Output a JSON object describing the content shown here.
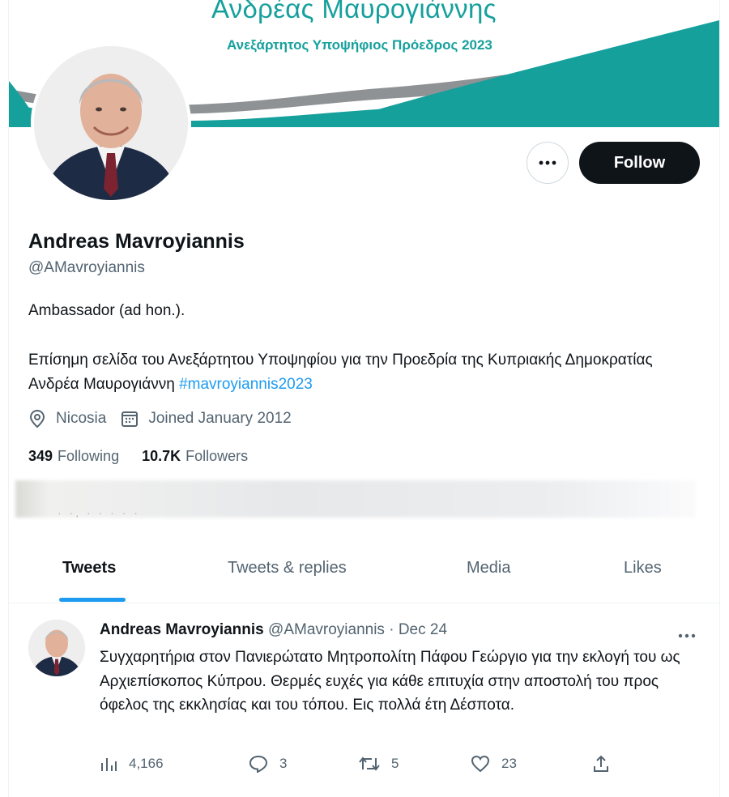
{
  "banner": {
    "title": "Ανδρέας Μαυρογιάννης",
    "subtitle": "Ανεξάρτητος Υποψήφιος Πρόεδρος 2023",
    "teal": "#16a09c"
  },
  "profile": {
    "display_name": "Andreas Mavroyiannis",
    "handle": "@AMavroyiannis",
    "bio_line1": "Ambassador (ad hon.).",
    "bio_line2": "Επίσημη σελίδα του Ανεξάρτητου Υποψηφίου για την Προεδρία της Κυπριακής Δημοκρατίας Ανδρέα Μαυρογιάννη ",
    "bio_hashtag": "#mavroyiannis2023",
    "location": "Nicosia",
    "joined": "Joined January 2012",
    "following_count": "349",
    "following_label": "Following",
    "followers_count": "10.7K",
    "followers_label": "Followers"
  },
  "actions": {
    "more_icon": "more-horizontal-icon",
    "follow_label": "Follow"
  },
  "tabs": [
    {
      "label": "Tweets",
      "active": true
    },
    {
      "label": "Tweets & replies",
      "active": false
    },
    {
      "label": "Media",
      "active": false
    },
    {
      "label": "Likes",
      "active": false
    }
  ],
  "tweet": {
    "author": "Andreas Mavroyiannis",
    "handle": "@AMavroyiannis",
    "separator": " · ",
    "date": "Dec 24",
    "text": "Συγχαρητήρια στον Πανιερώτατο Μητροπολίτη Πάφου Γεώργιο για την εκλογή του ως Αρχιεπίσκοπος Κύπρου. Θερμές ευχές για κάθε επιτυχία στην αποστολή του προς όφελος της εκκλησίας και του τόπου. Εις πολλά έτη Δέσποτα.",
    "views": "4,166",
    "replies": "3",
    "retweets": "5",
    "likes": "23"
  },
  "colors": {
    "accent": "#1d9bf0",
    "text": "#0f1419",
    "muted": "#536471",
    "button_dark": "#0f1419"
  }
}
